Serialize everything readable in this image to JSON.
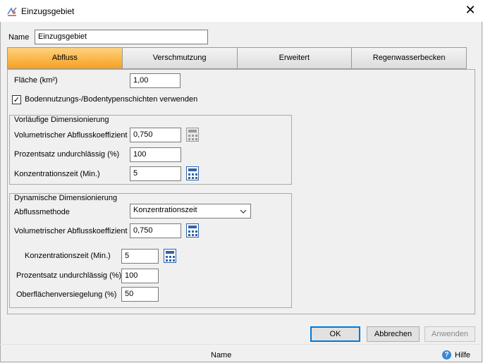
{
  "window": {
    "title": "Einzugsgebiet"
  },
  "name_field": {
    "label": "Name",
    "value": "Einzugsgebiet"
  },
  "tabs": [
    {
      "label": "Abfluss",
      "active": true
    },
    {
      "label": "Verschmutzung",
      "active": false
    },
    {
      "label": "Erweitert",
      "active": false
    },
    {
      "label": "Regenwasserbecken",
      "active": false
    }
  ],
  "area": {
    "label": "Fläche (km²)",
    "value": "1,00"
  },
  "land_use": {
    "label": "Bodennutzungs-/Bodentypenschichten verwenden",
    "checked": true
  },
  "prelim": {
    "title": "Vorläufige Dimensionierung",
    "runoff_coeff": {
      "label": "Volumetrischer Abflusskoeffizient",
      "value": "0,750"
    },
    "impervious": {
      "label": "Prozentsatz undurchlässig (%)",
      "value": "100"
    },
    "conc_time": {
      "label": "Konzentrationszeit (Min.)",
      "value": "5"
    }
  },
  "dynamic": {
    "title": "Dynamische Dimensionierung",
    "method": {
      "label": "Abflussmethode",
      "value": "Konzentrationszeit"
    },
    "runoff_coeff": {
      "label": "Volumetrischer Abflusskoeffizient",
      "value": "0,750"
    },
    "conc_time": {
      "label": "Konzentrationszeit (Min.)",
      "value": "5"
    },
    "impervious": {
      "label": "Prozentsatz undurchlässig (%)",
      "value": "100"
    },
    "sealing": {
      "label": "Oberflächenversiegelung (%)",
      "value": "50"
    }
  },
  "buttons": {
    "ok": "OK",
    "cancel": "Abbrechen",
    "apply": "Anwenden"
  },
  "status": {
    "text": "Name",
    "help": "Hilfe"
  },
  "colors": {
    "active_tab": "#f5a021",
    "accent": "#0078d7",
    "calc_icon": "#2f64a8"
  },
  "icons": [
    "app-icon",
    "close-icon",
    "calculator-icon",
    "chevron-down-icon",
    "help-icon",
    "check-icon"
  ]
}
